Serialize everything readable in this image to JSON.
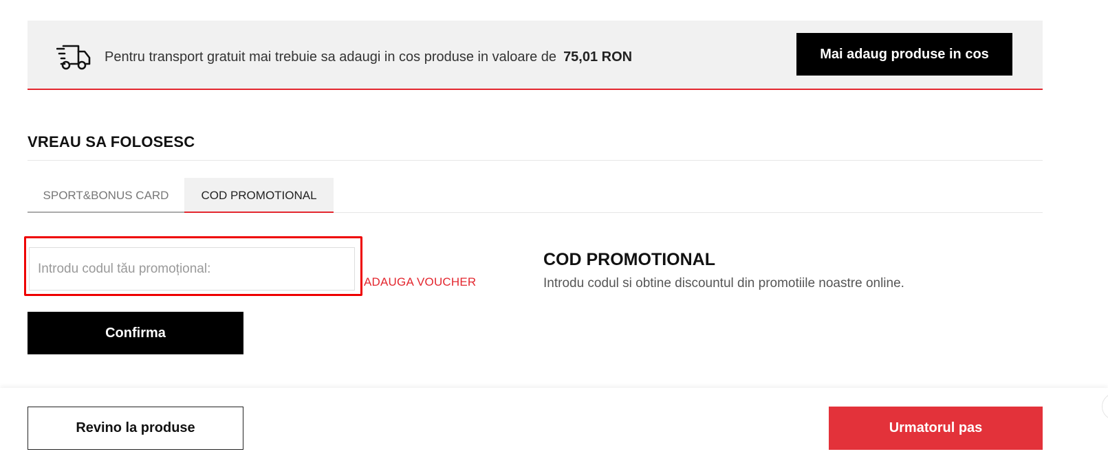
{
  "banner": {
    "text": "Pentru transport gratuit mai trebuie sa adaugi in cos produse in valoare de",
    "amount": "75,01 RON",
    "button_label": "Mai adaug produse in cos",
    "icon": "truck-icon"
  },
  "section": {
    "title": "VREAU SA FOLOSESC"
  },
  "tabs": [
    {
      "label": "SPORT&BONUS CARD",
      "active": false
    },
    {
      "label": "COD PROMOTIONAL",
      "active": true
    }
  ],
  "promo": {
    "placeholder": "Introdu codul tău promoțional:",
    "value": "",
    "voucher_link": "ADAUGA VOUCHER",
    "confirm_label": "Confirma",
    "info_title": "COD PROMOTIONAL",
    "info_desc": "Introdu codul si obtine discountul din promotiile noastre online."
  },
  "footer": {
    "back_label": "Revino la produse",
    "next_label": "Urmatorul pas"
  },
  "colors": {
    "accent_red": "#e3262e",
    "button_black": "#000000",
    "banner_bg": "#f1f1f1"
  }
}
